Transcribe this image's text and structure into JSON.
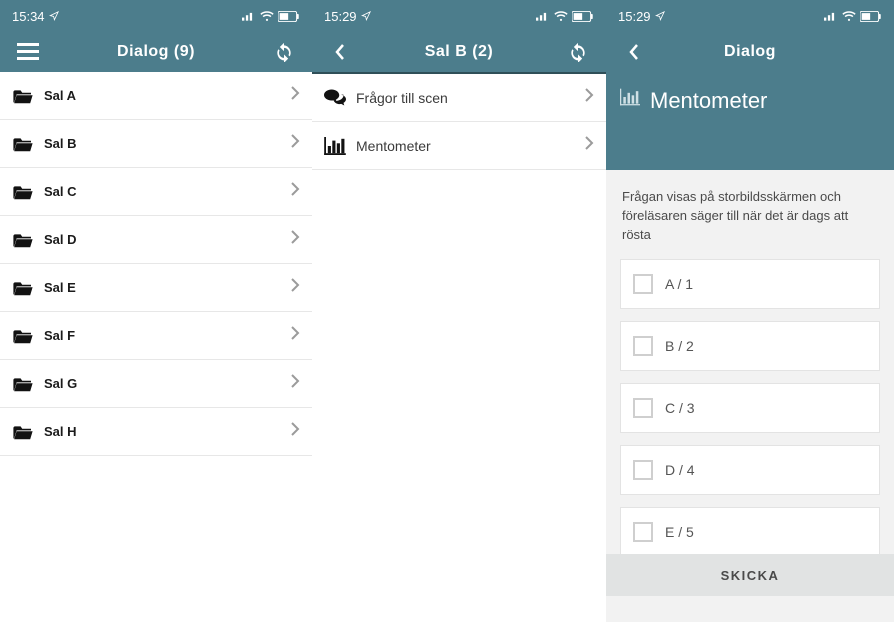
{
  "colors": {
    "brand": "#4c7d8c"
  },
  "pane1": {
    "status_time": "15:34",
    "title": "Dialog (9)",
    "items": [
      {
        "label": "Sal A"
      },
      {
        "label": "Sal B"
      },
      {
        "label": "Sal C"
      },
      {
        "label": "Sal D"
      },
      {
        "label": "Sal E"
      },
      {
        "label": "Sal F"
      },
      {
        "label": "Sal G"
      },
      {
        "label": "Sal H"
      }
    ]
  },
  "pane2": {
    "status_time": "15:29",
    "title": "Sal B (2)",
    "items": [
      {
        "icon": "speech",
        "label": "Frågor till scen"
      },
      {
        "icon": "barchart",
        "label": "Mentometer"
      }
    ]
  },
  "pane3": {
    "status_time": "15:29",
    "title": "Dialog",
    "hero_label": "Mentometer",
    "helper": "Frågan visas på storbildsskärmen och föreläsaren säger till när det är dags att rösta",
    "options": [
      {
        "label": "A / 1"
      },
      {
        "label": "B / 2"
      },
      {
        "label": "C / 3"
      },
      {
        "label": "D / 4"
      },
      {
        "label": "E / 5"
      }
    ],
    "submit": "SKICKA"
  }
}
